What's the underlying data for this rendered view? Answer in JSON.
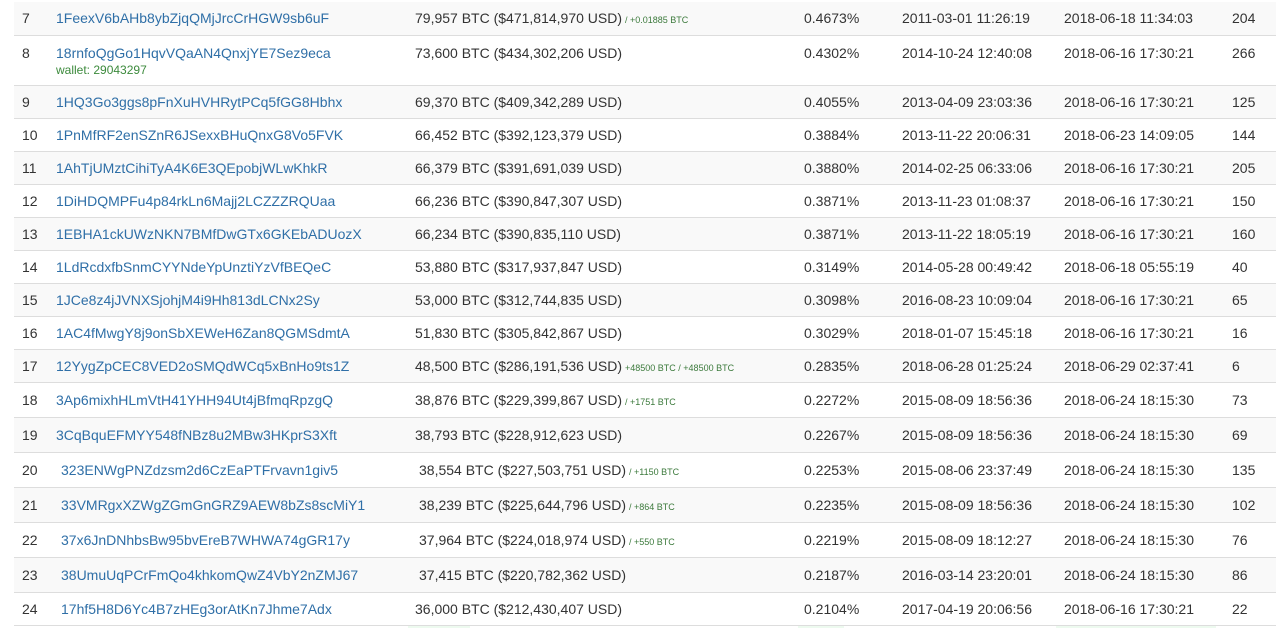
{
  "rows": [
    {
      "rank": "7",
      "address": "1FeexV6bAHb8ybZjqQMjJrcCrHGW9sb6uF",
      "wallet": "",
      "balance": "79,957 BTC ($471,814,970 USD)",
      "delta": "/ +0.01885 BTC",
      "percent": "0.4673%",
      "first_in": "2011-03-01 11:26:19",
      "last_in": "2018-06-18 11:34:03",
      "ins": "204"
    },
    {
      "rank": "8",
      "address": "18rnfoQgGo1HqvVQaAN4QnxjYE7Sez9eca",
      "wallet": "wallet: 29043297",
      "balance": "73,600 BTC ($434,302,206 USD)",
      "delta": "",
      "percent": "0.4302%",
      "first_in": "2014-10-24 12:40:08",
      "last_in": "2018-06-16 17:30:21",
      "ins": "266"
    },
    {
      "rank": "9",
      "address": "1HQ3Go3ggs8pFnXuHVHRytPCq5fGG8Hbhx",
      "wallet": "",
      "balance": "69,370 BTC ($409,342,289 USD)",
      "delta": "",
      "percent": "0.4055%",
      "first_in": "2013-04-09 23:03:36",
      "last_in": "2018-06-16 17:30:21",
      "ins": "125"
    },
    {
      "rank": "10",
      "address": "1PnMfRF2enSZnR6JSexxBHuQnxG8Vo5FVK",
      "wallet": "",
      "balance": "66,452 BTC ($392,123,379 USD)",
      "delta": "",
      "percent": "0.3884%",
      "first_in": "2013-11-22 20:06:31",
      "last_in": "2018-06-23 14:09:05",
      "ins": "144"
    },
    {
      "rank": "11",
      "address": "1AhTjUMztCihiTyA4K6E3QEpobjWLwKhkR",
      "wallet": "",
      "balance": "66,379 BTC ($391,691,039 USD)",
      "delta": "",
      "percent": "0.3880%",
      "first_in": "2014-02-25 06:33:06",
      "last_in": "2018-06-16 17:30:21",
      "ins": "205"
    },
    {
      "rank": "12",
      "address": "1DiHDQMPFu4p84rkLn6Majj2LCZZZRQUaa",
      "wallet": "",
      "balance": "66,236 BTC ($390,847,307 USD)",
      "delta": "",
      "percent": "0.3871%",
      "first_in": "2013-11-23 01:08:37",
      "last_in": "2018-06-16 17:30:21",
      "ins": "150"
    },
    {
      "rank": "13",
      "address": "1EBHA1ckUWzNKN7BMfDwGTx6GKEbADUozX",
      "wallet": "",
      "balance": "66,234 BTC ($390,835,110 USD)",
      "delta": "",
      "percent": "0.3871%",
      "first_in": "2013-11-22 18:05:19",
      "last_in": "2018-06-16 17:30:21",
      "ins": "160"
    },
    {
      "rank": "14",
      "address": "1LdRcdxfbSnmCYYNdeYpUnztiYzVfBEQeC",
      "wallet": "",
      "balance": "53,880 BTC ($317,937,847 USD)",
      "delta": "",
      "percent": "0.3149%",
      "first_in": "2014-05-28 00:49:42",
      "last_in": "2018-06-18 05:55:19",
      "ins": "40"
    },
    {
      "rank": "15",
      "address": "1JCe8z4jJVNXSjohjM4i9Hh813dLCNx2Sy",
      "wallet": "",
      "balance": "53,000 BTC ($312,744,835 USD)",
      "delta": "",
      "percent": "0.3098%",
      "first_in": "2016-08-23 10:09:04",
      "last_in": "2018-06-16 17:30:21",
      "ins": "65"
    },
    {
      "rank": "16",
      "address": "1AC4fMwgY8j9onSbXEWeH6Zan8QGMSdmtA",
      "wallet": "",
      "balance": "51,830 BTC ($305,842,867 USD)",
      "delta": "",
      "percent": "0.3029%",
      "first_in": "2018-01-07 15:45:18",
      "last_in": "2018-06-16 17:30:21",
      "ins": "16"
    },
    {
      "rank": "17",
      "address": "12YygZpCEC8VED2oSMQdWCq5xBnHo9ts1Z",
      "wallet": "",
      "balance": "48,500 BTC ($286,191,536 USD)",
      "delta": "+48500 BTC / +48500 BTC",
      "percent": "0.2835%",
      "first_in": "2018-06-28 01:25:24",
      "last_in": "2018-06-29 02:37:41",
      "ins": "6"
    },
    {
      "rank": "18",
      "address": "3Ap6mixhHLmVtH41YHH94Ut4jBfmqRpzgQ",
      "wallet": "",
      "balance": "38,876 BTC ($229,399,867 USD)",
      "delta": "/ +1751 BTC",
      "percent": "0.2272%",
      "first_in": "2015-08-09 18:56:36",
      "last_in": "2018-06-24 18:15:30",
      "ins": "73"
    },
    {
      "rank": "19",
      "address": "3CqBquEFMYY548fNBz8u2MBw3HKprS3Xft",
      "wallet": "",
      "balance": "38,793 BTC ($228,912,623 USD)",
      "delta": "",
      "percent": "0.2267%",
      "first_in": "2015-08-09 18:56:36",
      "last_in": "2018-06-24 18:15:30",
      "ins": "69"
    },
    {
      "rank": "20",
      "address": "323ENWgPNZdzsm2d6CzEaPTFrvavn1giv5",
      "wallet": "",
      "balance": "38,554 BTC ($227,503,751 USD)",
      "delta": "/ +1150 BTC",
      "percent": "0.2253%",
      "first_in": "2015-08-06 23:37:49",
      "last_in": "2018-06-24 18:15:30",
      "ins": "135"
    },
    {
      "rank": "21",
      "address": "33VMRgxXZWgZGmGnGRZ9AEW8bZs8scMiY1",
      "wallet": "",
      "balance": "38,239 BTC ($225,644,796 USD)",
      "delta": "/ +864 BTC",
      "percent": "0.2235%",
      "first_in": "2015-08-09 18:56:36",
      "last_in": "2018-06-24 18:15:30",
      "ins": "102"
    },
    {
      "rank": "22",
      "address": "37x6JnDNhbsBw95bvEreB7WHWA74gGR17y",
      "wallet": "",
      "balance": "37,964 BTC ($224,018,974 USD)",
      "delta": "/ +550 BTC",
      "percent": "0.2219%",
      "first_in": "2015-08-09 18:12:27",
      "last_in": "2018-06-24 18:15:30",
      "ins": "76"
    },
    {
      "rank": "23",
      "address": "38UmuUqPCrFmQo4khkomQwZ4VbY2nZMJ67",
      "wallet": "",
      "balance": "37,415 BTC ($220,782,362 USD)",
      "delta": "",
      "percent": "0.2187%",
      "first_in": "2016-03-14 23:20:01",
      "last_in": "2018-06-24 18:15:30",
      "ins": "86"
    },
    {
      "rank": "24",
      "address": "17hf5H8D6Yc4B7zHEg3orAtKn7Jhme7Adx",
      "wallet": "",
      "balance": "36,000 BTC ($212,430,407 USD)",
      "delta": "",
      "percent": "0.2104%",
      "first_in": "2017-04-19 20:06:56",
      "last_in": "2018-06-16 17:30:21",
      "ins": "22"
    }
  ]
}
